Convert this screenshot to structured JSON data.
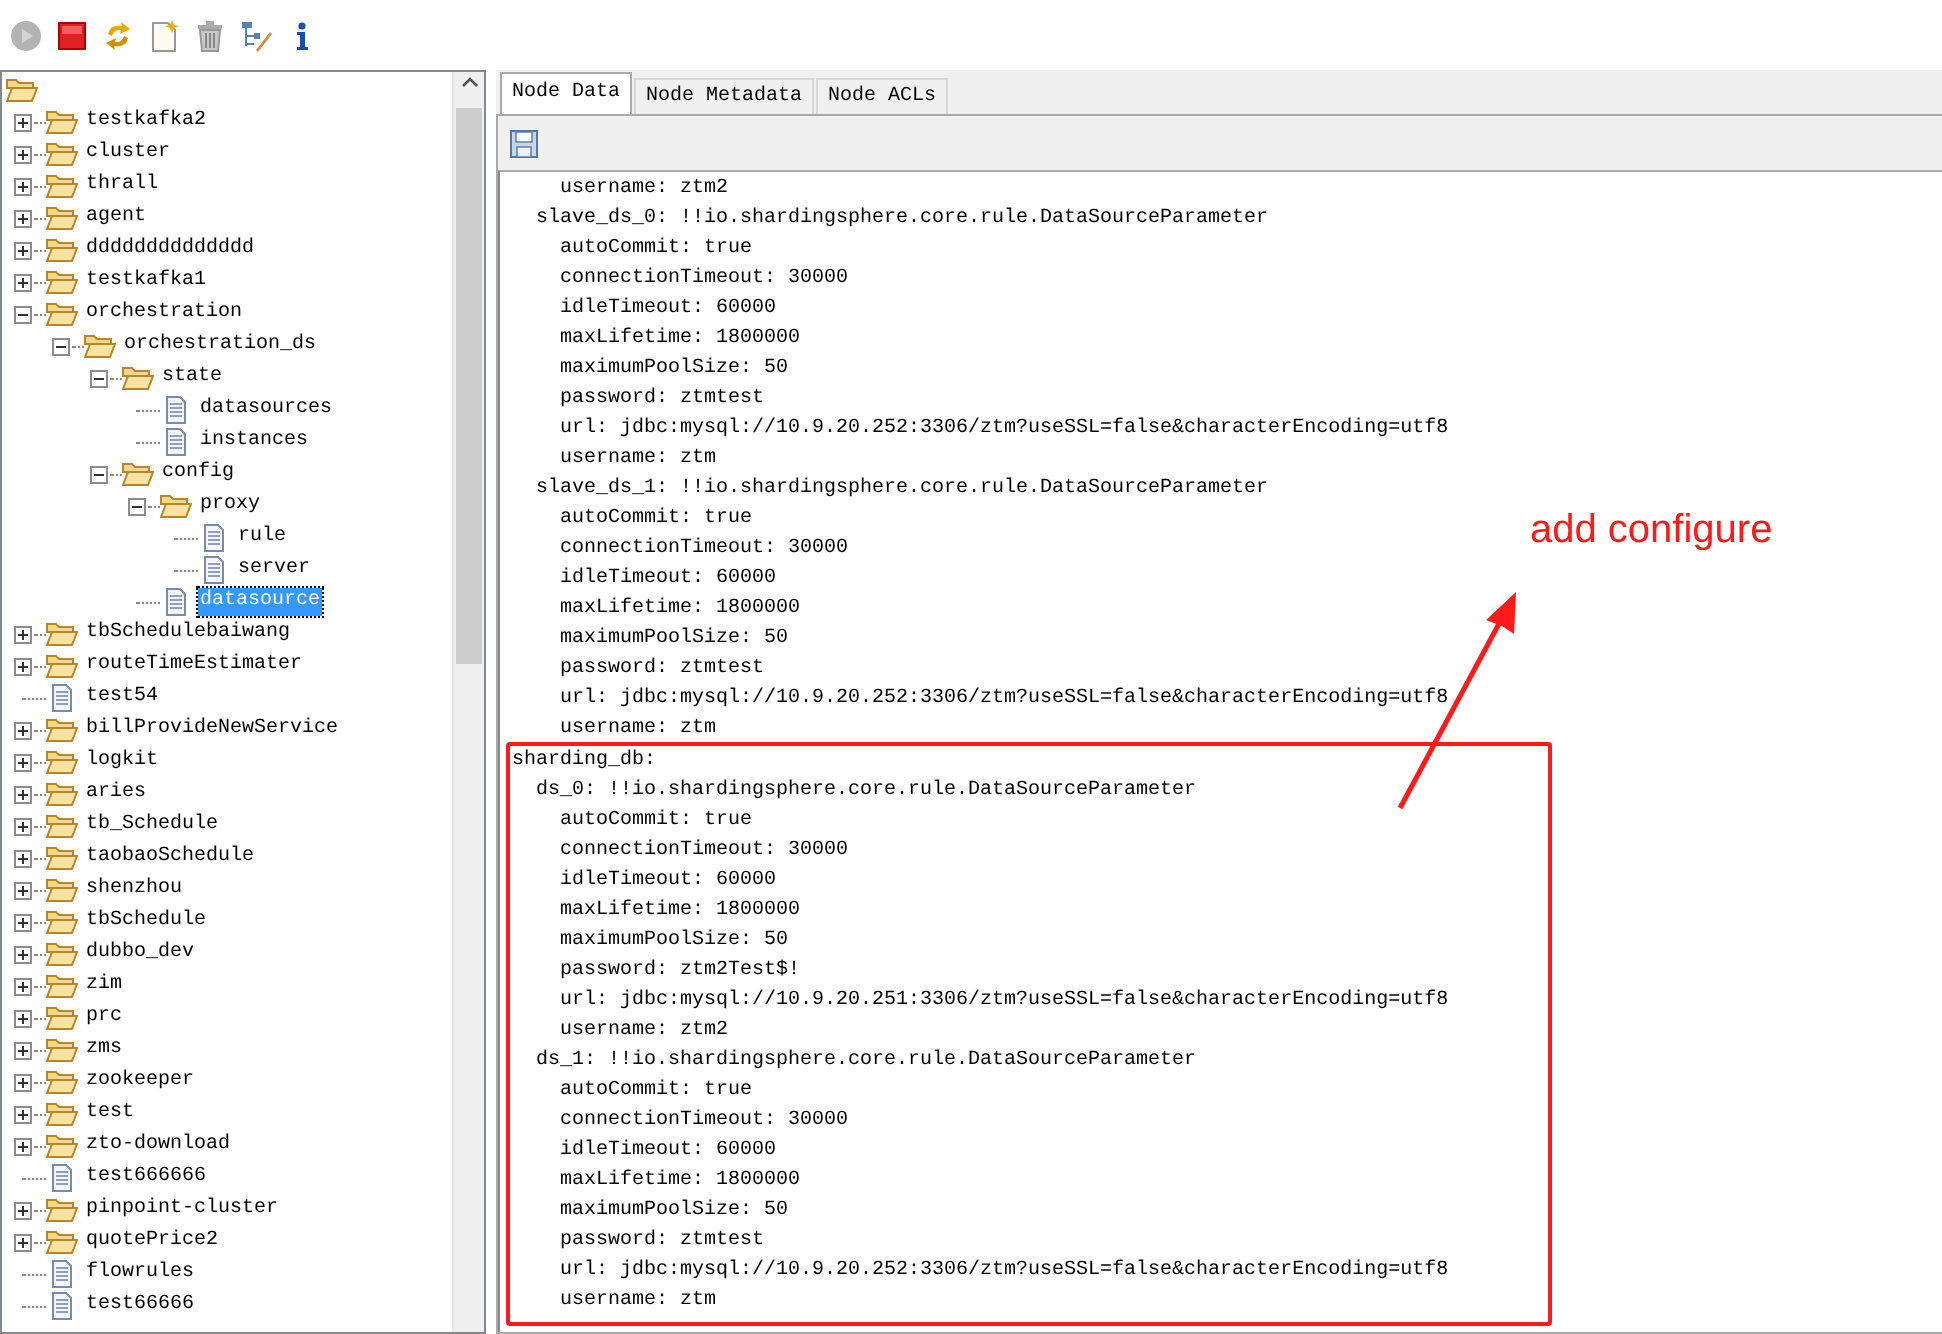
{
  "toolbar": [
    {
      "kind": "play",
      "disabled": true
    },
    {
      "kind": "stop",
      "disabled": false
    },
    {
      "kind": "refresh",
      "disabled": false
    },
    {
      "kind": "add",
      "disabled": false
    },
    {
      "kind": "delete",
      "disabled": false
    },
    {
      "kind": "edit-tree",
      "disabled": false
    },
    {
      "kind": "info",
      "disabled": false
    }
  ],
  "tree": {
    "items": [
      {
        "label": "testkafka2",
        "kind": "folder",
        "expanded": false,
        "selected": false
      },
      {
        "label": "cluster",
        "kind": "folder",
        "expanded": false,
        "selected": false
      },
      {
        "label": "thrall",
        "kind": "folder",
        "expanded": false,
        "selected": false
      },
      {
        "label": "agent",
        "kind": "folder",
        "expanded": false,
        "selected": false
      },
      {
        "label": "dddddddddddddd",
        "kind": "folder",
        "expanded": false,
        "selected": false
      },
      {
        "label": "testkafka1",
        "kind": "folder",
        "expanded": false,
        "selected": false
      },
      {
        "label": "orchestration",
        "kind": "folder",
        "expanded": true,
        "selected": false,
        "children": [
          {
            "label": "orchestration_ds",
            "kind": "folder",
            "expanded": true,
            "selected": false,
            "children": [
              {
                "label": "state",
                "kind": "folder",
                "expanded": true,
                "selected": false,
                "children": [
                  {
                    "label": "datasources",
                    "kind": "file",
                    "selected": false
                  },
                  {
                    "label": "instances",
                    "kind": "file",
                    "selected": false
                  }
                ]
              },
              {
                "label": "config",
                "kind": "folder",
                "expanded": true,
                "selected": false,
                "children": [
                  {
                    "label": "proxy",
                    "kind": "folder",
                    "expanded": true,
                    "selected": false,
                    "children": [
                      {
                        "label": "rule",
                        "kind": "file",
                        "selected": false
                      },
                      {
                        "label": "server",
                        "kind": "file",
                        "selected": false
                      }
                    ]
                  },
                  {
                    "label": "datasource",
                    "kind": "file",
                    "selected": true
                  }
                ]
              }
            ]
          }
        ]
      },
      {
        "label": "tbSchedulebaiwang",
        "kind": "folder",
        "expanded": false,
        "selected": false
      },
      {
        "label": "routeTimeEstimater",
        "kind": "folder",
        "expanded": false,
        "selected": false
      },
      {
        "label": "test54",
        "kind": "file",
        "selected": false
      },
      {
        "label": "billProvideNewService",
        "kind": "folder",
        "expanded": false,
        "selected": false
      },
      {
        "label": "logkit",
        "kind": "folder",
        "expanded": false,
        "selected": false
      },
      {
        "label": "aries",
        "kind": "folder",
        "expanded": false,
        "selected": false
      },
      {
        "label": "tb_Schedule",
        "kind": "folder",
        "expanded": false,
        "selected": false
      },
      {
        "label": "taobaoSchedule",
        "kind": "folder",
        "expanded": false,
        "selected": false
      },
      {
        "label": "shenzhou",
        "kind": "folder",
        "expanded": false,
        "selected": false
      },
      {
        "label": "tbSchedule",
        "kind": "folder",
        "expanded": false,
        "selected": false
      },
      {
        "label": "dubbo_dev",
        "kind": "folder",
        "expanded": false,
        "selected": false
      },
      {
        "label": "zim",
        "kind": "folder",
        "expanded": false,
        "selected": false
      },
      {
        "label": "prc",
        "kind": "folder",
        "expanded": false,
        "selected": false
      },
      {
        "label": "zms",
        "kind": "folder",
        "expanded": false,
        "selected": false
      },
      {
        "label": "zookeeper",
        "kind": "folder",
        "expanded": false,
        "selected": false
      },
      {
        "label": "test",
        "kind": "folder",
        "expanded": false,
        "selected": false
      },
      {
        "label": "zto-download",
        "kind": "folder",
        "expanded": false,
        "selected": false
      },
      {
        "label": "test666666",
        "kind": "file",
        "selected": false
      },
      {
        "label": "pinpoint-cluster",
        "kind": "folder",
        "expanded": false,
        "selected": false
      },
      {
        "label": "quotePrice2",
        "kind": "folder",
        "expanded": false,
        "selected": false
      },
      {
        "label": "flowrules",
        "kind": "file",
        "selected": false
      },
      {
        "label": "test66666",
        "kind": "file",
        "selected": false
      }
    ]
  },
  "tabs": [
    {
      "label": "Node Data",
      "selected": true
    },
    {
      "label": "Node Metadata",
      "selected": false
    },
    {
      "label": "Node ACLs",
      "selected": false
    }
  ],
  "editor": {
    "lines": [
      "    username: ztm2",
      "  slave_ds_0: !!io.shardingsphere.core.rule.DataSourceParameter",
      "    autoCommit: true",
      "    connectionTimeout: 30000",
      "    idleTimeout: 60000",
      "    maxLifetime: 1800000",
      "    maximumPoolSize: 50",
      "    password: ztmtest",
      "    url: jdbc:mysql://10.9.20.252:3306/ztm?useSSL=false&characterEncoding=utf8",
      "    username: ztm",
      "  slave_ds_1: !!io.shardingsphere.core.rule.DataSourceParameter",
      "    autoCommit: true",
      "    connectionTimeout: 30000",
      "    idleTimeout: 60000",
      "    maxLifetime: 1800000",
      "    maximumPoolSize: 50",
      "    password: ztmtest",
      "    url: jdbc:mysql://10.9.20.252:3306/ztm?useSSL=false&characterEncoding=utf8",
      "    username: ztm"
    ],
    "highlight": {
      "lines": [
        "sharding_db:",
        "  ds_0: !!io.shardingsphere.core.rule.DataSourceParameter",
        "    autoCommit: true",
        "    connectionTimeout: 30000",
        "    idleTimeout: 60000",
        "    maxLifetime: 1800000",
        "    maximumPoolSize: 50",
        "    password: ztm2Test$!",
        "    url: jdbc:mysql://10.9.20.251:3306/ztm?useSSL=false&characterEncoding=utf8",
        "    username: ztm2",
        "  ds_1: !!io.shardingsphere.core.rule.DataSourceParameter",
        "    autoCommit: true",
        "    connectionTimeout: 30000",
        "    idleTimeout: 60000",
        "    maxLifetime: 1800000",
        "    maximumPoolSize: 50",
        "    password: ztmtest",
        "    url: jdbc:mysql://10.9.20.252:3306/ztm?useSSL=false&characterEncoding=utf8",
        "    username: ztm"
      ]
    }
  },
  "annotation": {
    "text": "add configure"
  }
}
